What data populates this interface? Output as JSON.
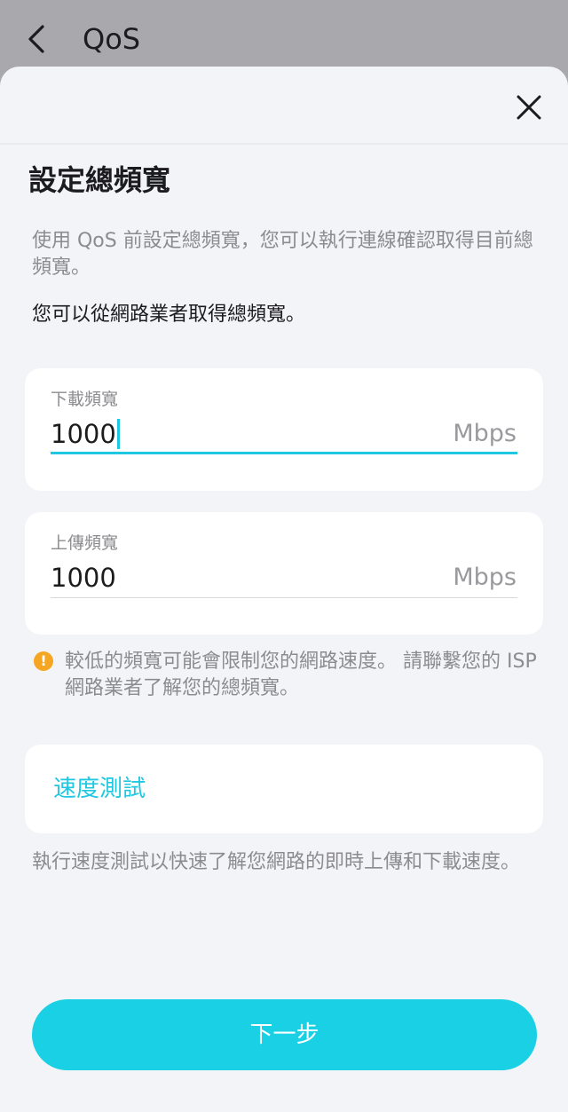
{
  "background": {
    "title": "QoS"
  },
  "sheet": {
    "title": "設定總頻寬",
    "description": "使用 QoS 前設定總頻寬，您可以執行連線確認取得目前總頻寬。",
    "hint": "您可以從網路業者取得總頻寬。",
    "download": {
      "label": "下載頻寬",
      "value": "1000",
      "unit": "Mbps"
    },
    "upload": {
      "label": "上傳頻寬",
      "value": "1000",
      "unit": "Mbps"
    },
    "warning": "較低的頻寬可能會限制您的網路速度。 請聯繫您的 ISP 網路業者了解您的總頻寬。",
    "speed_test": {
      "label": "速度測試",
      "description": "執行速度測試以快速了解您網路的即時上傳和下載速度。"
    },
    "next_label": "下一步"
  },
  "icons": {
    "back": "chevron-left-icon",
    "close": "close-icon",
    "warning": "exclamation-circle-icon"
  },
  "colors": {
    "accent": "#1ad0e5",
    "warning": "#f5a623",
    "sheet_background": "#f3f4f8",
    "overlay": "#a9a9ad"
  }
}
